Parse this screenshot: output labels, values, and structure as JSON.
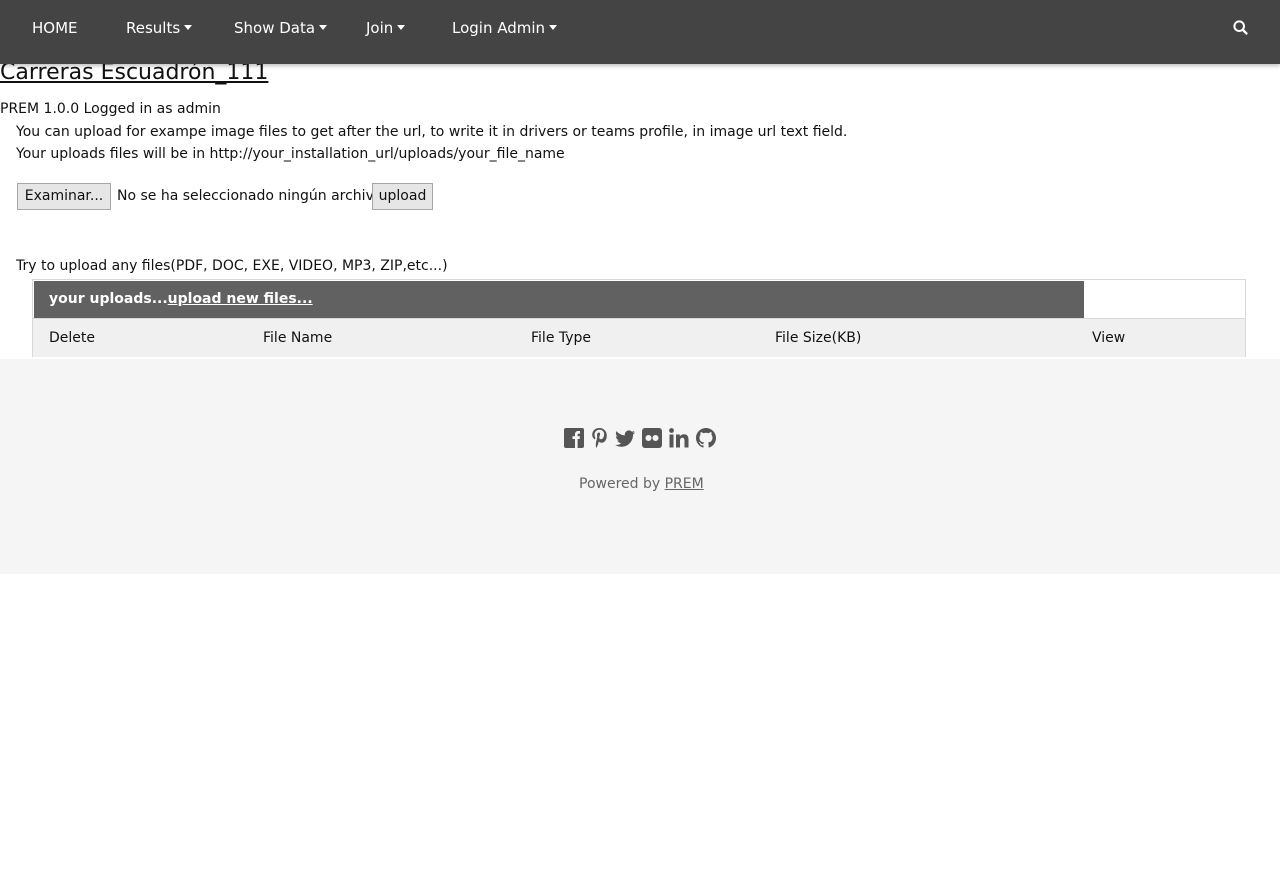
{
  "nav": {
    "home": "HOME",
    "results": "Results",
    "show_data": "Show Data",
    "join": "Join",
    "login_admin": "Login Admin"
  },
  "page": {
    "title": "Carreras Escuadrón_111",
    "version_status": "PREM 1.0.0  Logged in as admin",
    "info_line1": "You can upload for exampe image files to get after the url, to write it in drivers or teams profile, in image url text field.",
    "info_line2": "Your uploads files will be in http://your_installation_url/uploads/your_file_name"
  },
  "upload": {
    "browse_label": "Examinar...",
    "no_file_text": "No se ha seleccionado ningún archivo.",
    "upload_label": "upload",
    "hint": "Try to upload any files(PDF, DOC, EXE, VIDEO, MP3, ZIP,etc...)"
  },
  "uploads_table": {
    "title_prefix": "your uploads...",
    "title_link": "upload new files...",
    "columns": [
      "Delete",
      "File Name",
      "File Type",
      "File Size(KB)",
      "View"
    ]
  },
  "footer": {
    "powered_prefix": "Powered by ",
    "powered_link": "PREM",
    "social_icons": [
      "facebook-icon",
      "pinterest-icon",
      "twitter-icon",
      "flickr-icon",
      "linkedin-icon",
      "github-icon"
    ]
  },
  "colors": {
    "topbar": "#444444",
    "table_header": "#616161",
    "footer": "#f5f5f5"
  }
}
